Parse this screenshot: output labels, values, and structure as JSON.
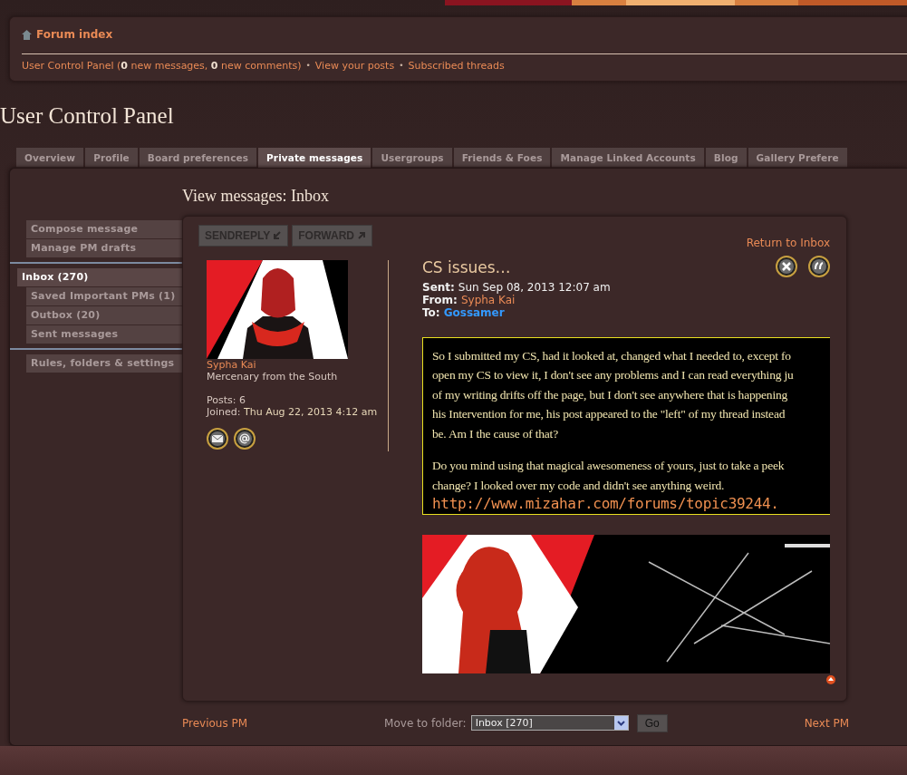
{
  "navbar": {
    "home": "Forum index",
    "links": [
      "User Control Panel (**0** new messages, **0** new comments)",
      "View your posts",
      "Subscribed threads"
    ],
    "separator": "•"
  },
  "title": "User Control Panel",
  "tabs": [
    {
      "label": "Overview",
      "selected": false
    },
    {
      "label": "Profile",
      "selected": false
    },
    {
      "label": "Board preferences",
      "selected": false
    },
    {
      "label": "Private messages",
      "selected": true
    },
    {
      "label": "Usergroups",
      "selected": false
    },
    {
      "label": "Friends & Foes",
      "selected": false
    },
    {
      "label": "Manage Linked Accounts",
      "selected": false
    },
    {
      "label": "Blog",
      "selected": false
    },
    {
      "label": "Gallery Prefere",
      "selected": false
    }
  ],
  "heading": "View messages: Inbox",
  "menu": [
    [
      {
        "label": "Compose message",
        "selected": false
      },
      {
        "label": "Manage PM drafts",
        "selected": false
      }
    ],
    [
      {
        "label": "Inbox (270)",
        "selected": true
      },
      {
        "label": "Saved Important PMs (1)",
        "selected": false
      },
      {
        "label": "Outbox (20)",
        "selected": false
      },
      {
        "label": "Sent messages",
        "selected": false
      }
    ],
    [
      {
        "label": "Rules, folders & settings",
        "selected": false
      }
    ]
  ],
  "buttons": [
    "SENDREPLY",
    "FORWARD"
  ],
  "return_link": "Return to Inbox",
  "author": {
    "name": "Sypha Kai",
    "rank": "Mercenary from the South",
    "posts_label": "Posts:",
    "posts": "6",
    "joined_label": "Joined:",
    "joined": "Thu Aug 22, 2013 4:12 am"
  },
  "message": {
    "subject": "CS issues…",
    "meta": [
      {
        "label": "Sent:",
        "value": "Sun Sep 08, 2013 12:07 am",
        "kind": "text"
      },
      {
        "label": "From:",
        "value": "Sypha Kai",
        "kind": "user",
        "color": "#e98a55"
      },
      {
        "label": "To:",
        "value": "Gossamer",
        "kind": "user",
        "color": "#3399ff"
      }
    ],
    "paragraphs": [
      [
        "So I submitted my CS, had it looked at, changed what I needed to, except fo",
        "open my CS to view it, I don't see any problems and I can read everything ju",
        "of my writing drifts off the page, but I don't see anywhere that is happening",
        "his Intervention for me, his post appeared to the \"left\" of my thread instead",
        "be. Am I the cause of that?"
      ],
      [
        "Do you mind using that magical awesomeness of yours, just to take a peek",
        "change? I looked over my code and didn't see anything weird."
      ]
    ],
    "url": "http://www.mizahar.com/forums/topic39244."
  },
  "footer": {
    "previous": "Previous PM",
    "move_label": "Move to folder:",
    "folder": "Inbox [270]",
    "go": "Go",
    "next": "Next PM"
  }
}
